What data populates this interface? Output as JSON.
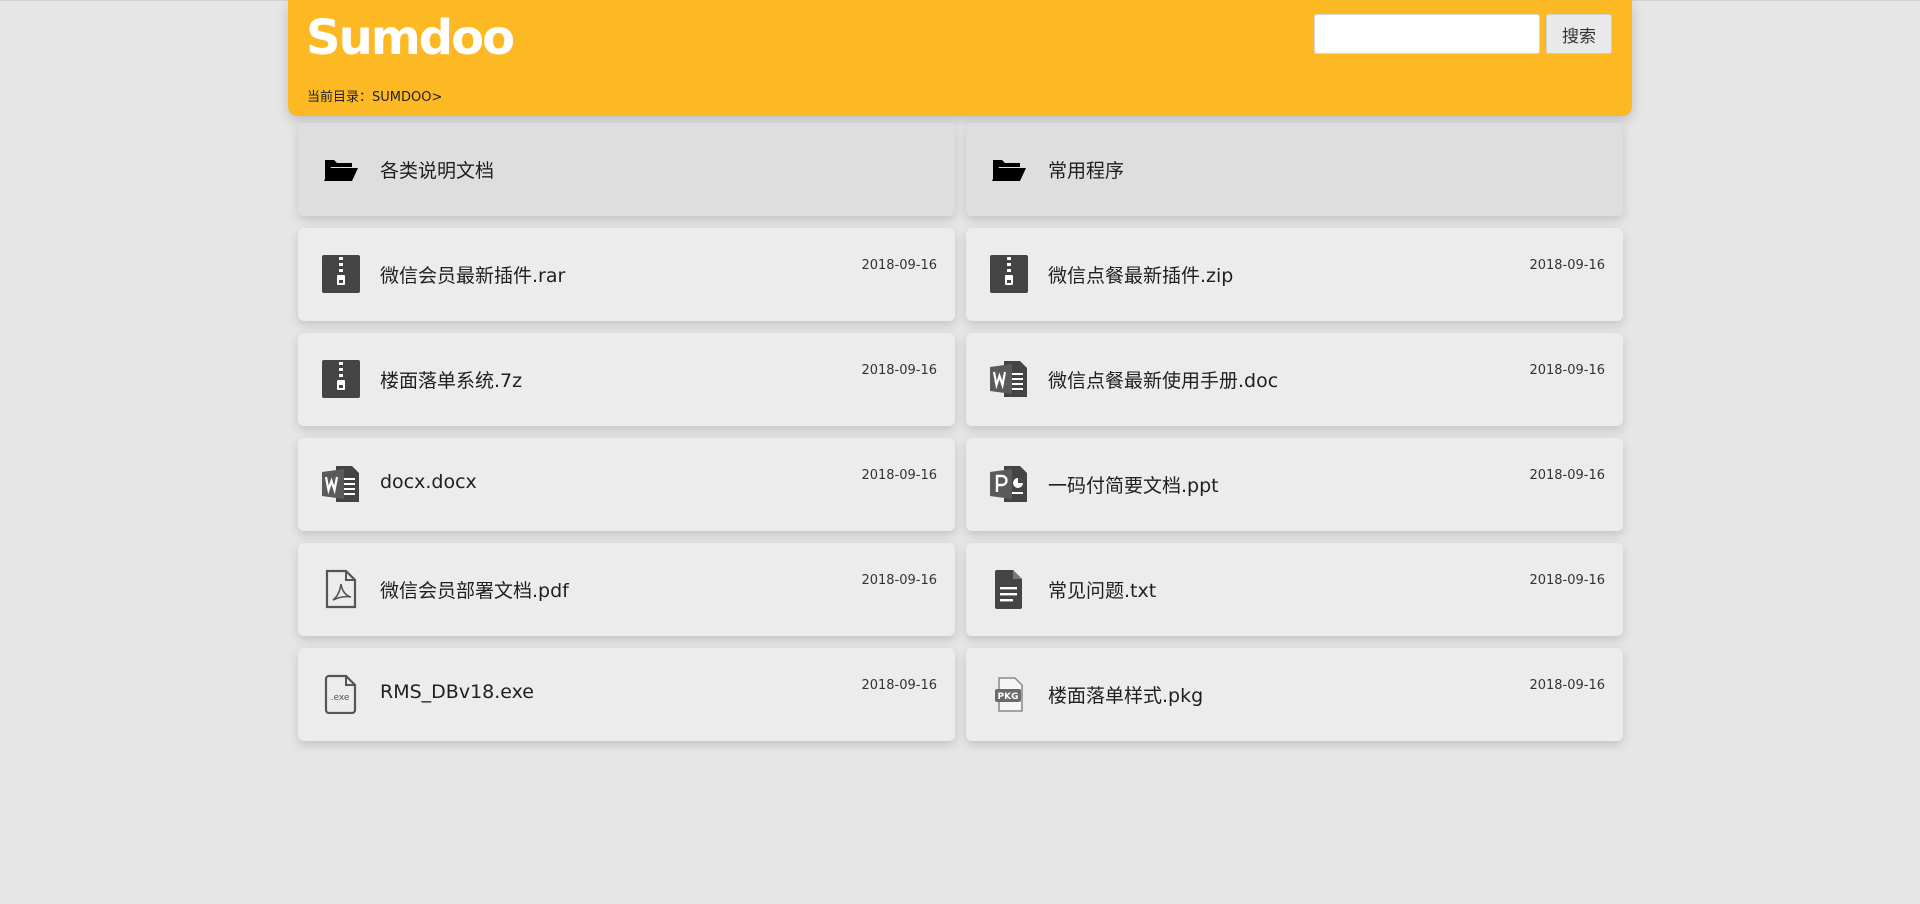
{
  "header": {
    "logo_text": "Sumdoo",
    "breadcrumb": "当前目录：SUMDOO>",
    "search_placeholder": "",
    "search_button": "搜索",
    "colors": {
      "header_bg": "#fdb923",
      "page_bg": "#e6e6e6"
    }
  },
  "items": [
    {
      "name": "各类说明文档",
      "date": "",
      "icon": "folder-icon",
      "type": "folder"
    },
    {
      "name": "常用程序",
      "date": "",
      "icon": "folder-icon",
      "type": "folder"
    },
    {
      "name": "微信会员最新插件.rar",
      "date": "2018-09-16",
      "icon": "archive-icon",
      "type": "file"
    },
    {
      "name": "微信点餐最新插件.zip",
      "date": "2018-09-16",
      "icon": "archive-icon",
      "type": "file"
    },
    {
      "name": "楼面落单系统.7z",
      "date": "2018-09-16",
      "icon": "archive-icon",
      "type": "file"
    },
    {
      "name": "微信点餐最新使用手册.doc",
      "date": "2018-09-16",
      "icon": "word-icon",
      "type": "file"
    },
    {
      "name": "docx.docx",
      "date": "2018-09-16",
      "icon": "word-icon",
      "type": "file"
    },
    {
      "name": "一码付简要文档.ppt",
      "date": "2018-09-16",
      "icon": "powerpoint-icon",
      "type": "file"
    },
    {
      "name": "微信会员部署文档.pdf",
      "date": "2018-09-16",
      "icon": "pdf-icon",
      "type": "file"
    },
    {
      "name": "常见问题.txt",
      "date": "2018-09-16",
      "icon": "text-file-icon",
      "type": "file"
    },
    {
      "name": "RMS_DBv18.exe",
      "date": "2018-09-16",
      "icon": "exe-file-icon",
      "type": "file"
    },
    {
      "name": "楼面落单样式.pkg",
      "date": "2018-09-16",
      "icon": "package-icon",
      "type": "file"
    }
  ]
}
